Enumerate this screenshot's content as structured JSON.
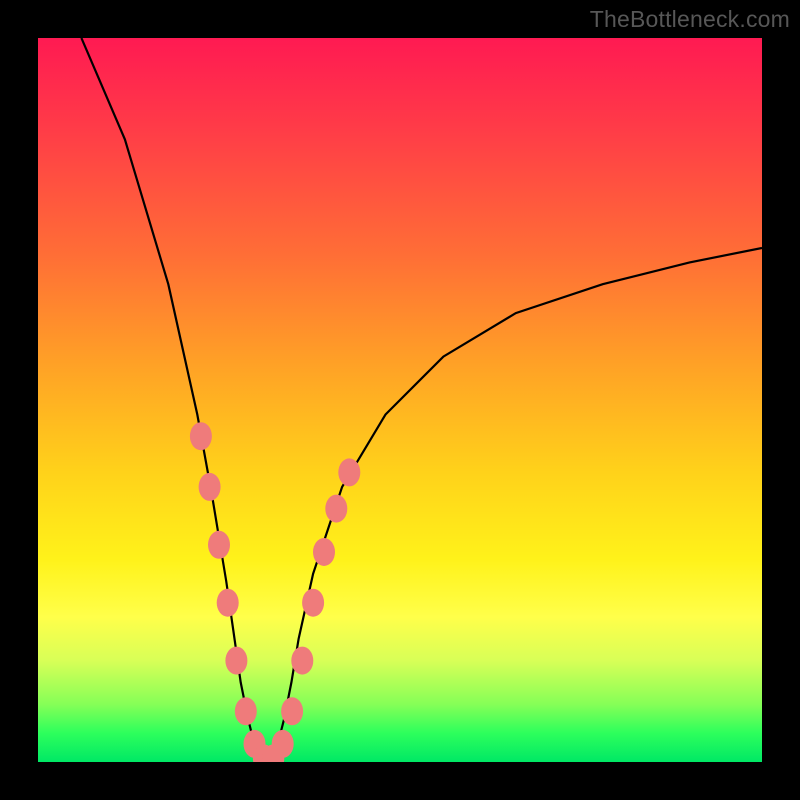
{
  "attribution": "TheBottleneck.com",
  "chart_data": {
    "type": "line",
    "title": "",
    "xlabel": "",
    "ylabel": "",
    "xlim": [
      0,
      100
    ],
    "ylim": [
      0,
      100
    ],
    "series": [
      {
        "name": "curve",
        "x": [
          6,
          12,
          18,
          22,
          24,
          26,
          27,
          28,
          29,
          30,
          31,
          32,
          33,
          34,
          35,
          36,
          38,
          42,
          48,
          56,
          66,
          78,
          90,
          100
        ],
        "values": [
          100,
          86,
          66,
          48,
          37,
          25,
          18,
          11,
          6,
          2,
          0,
          0,
          2,
          6,
          11,
          17,
          26,
          38,
          48,
          56,
          62,
          66,
          69,
          71
        ]
      }
    ],
    "highlights": {
      "name": "pink-blobs",
      "points": [
        {
          "x": 22.5,
          "y": 45
        },
        {
          "x": 23.7,
          "y": 38
        },
        {
          "x": 25.0,
          "y": 30
        },
        {
          "x": 26.2,
          "y": 22
        },
        {
          "x": 27.4,
          "y": 14
        },
        {
          "x": 28.7,
          "y": 7
        },
        {
          "x": 29.9,
          "y": 2.5
        },
        {
          "x": 31.2,
          "y": 0.5
        },
        {
          "x": 32.5,
          "y": 0.5
        },
        {
          "x": 33.8,
          "y": 2.5
        },
        {
          "x": 35.1,
          "y": 7
        },
        {
          "x": 36.5,
          "y": 14
        },
        {
          "x": 38.0,
          "y": 22
        },
        {
          "x": 39.5,
          "y": 29
        },
        {
          "x": 41.2,
          "y": 35
        },
        {
          "x": 43.0,
          "y": 40
        }
      ]
    },
    "colors": {
      "curve_stroke": "#000000",
      "highlight_fill": "#ef7b7b"
    }
  }
}
